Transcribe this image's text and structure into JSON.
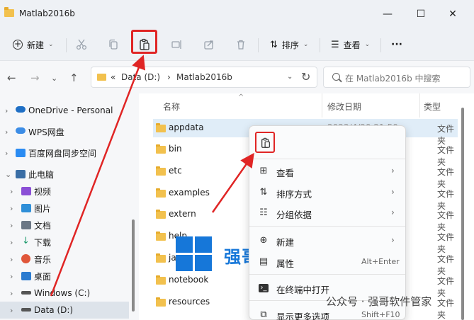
{
  "window": {
    "title": "Matlab2016b"
  },
  "window_controls": {
    "minimize": "—",
    "maximize": "☐",
    "close": "✕"
  },
  "toolbar": {
    "new_label": "新建",
    "sort_label": "排序",
    "view_label": "查看",
    "more_label": "···",
    "icons": [
      "cut-icon",
      "copy-icon",
      "paste-icon",
      "rename-icon",
      "share-icon",
      "delete-icon"
    ]
  },
  "address": {
    "overflow": "«",
    "drive": "Data (D:)",
    "separator": "›",
    "folder": "Matlab2016b"
  },
  "search": {
    "placeholder": "在 Matlab2016b 中搜索"
  },
  "sidebar": {
    "items": [
      {
        "label": "OneDrive - Personal",
        "icon": "onedrive-icon",
        "color": "#1f6fc5"
      },
      {
        "label": "WPS网盘",
        "icon": "wps-cloud-icon",
        "color": "#3c8de6"
      },
      {
        "label": "百度网盘同步空间",
        "icon": "baidu-netdisk-icon",
        "color": "#2a8bf2"
      },
      {
        "label": "此电脑",
        "icon": "this-pc-icon",
        "color": "#3a6ea5"
      },
      {
        "label": "视频",
        "icon": "videos-icon",
        "color": "#8b4fd6"
      },
      {
        "label": "图片",
        "icon": "pictures-icon",
        "color": "#2f8fd8"
      },
      {
        "label": "文档",
        "icon": "documents-icon",
        "color": "#6b7785"
      },
      {
        "label": "下载",
        "icon": "downloads-icon",
        "color": "#1d9a6c"
      },
      {
        "label": "音乐",
        "icon": "music-icon",
        "color": "#e0573a"
      },
      {
        "label": "桌面",
        "icon": "desktop-icon",
        "color": "#2b7bd0"
      },
      {
        "label": "Windows (C:)",
        "icon": "drive-c-icon",
        "color": "#555555"
      },
      {
        "label": "Data (D:)",
        "icon": "drive-d-icon",
        "color": "#555555"
      }
    ]
  },
  "columns": {
    "name": "名称",
    "modified": "修改日期",
    "type": "类型"
  },
  "files": [
    {
      "name": "appdata",
      "date": "2023/4/20 21:50",
      "type": "文件夹"
    },
    {
      "name": "bin",
      "date": "",
      "type": "文件夹"
    },
    {
      "name": "etc",
      "date": "",
      "type": "文件夹"
    },
    {
      "name": "examples",
      "date": "",
      "type": "文件夹"
    },
    {
      "name": "extern",
      "date": "",
      "type": "文件夹"
    },
    {
      "name": "help",
      "date": "",
      "type": "文件夹"
    },
    {
      "name": "java",
      "date": "",
      "type": "文件夹"
    },
    {
      "name": "notebook",
      "date": "",
      "type": "文件夹"
    },
    {
      "name": "resources",
      "date": "",
      "type": "文件夹"
    }
  ],
  "context_menu": {
    "items": [
      {
        "label": "查看",
        "icon": "grid-view-icon",
        "chevron": "›"
      },
      {
        "label": "排序方式",
        "icon": "sort-icon",
        "chevron": "›"
      },
      {
        "label": "分组依据",
        "icon": "group-by-icon",
        "chevron": "›"
      },
      {
        "label": "新建",
        "icon": "new-plus-icon",
        "chevron": "›"
      },
      {
        "label": "属性",
        "icon": "properties-icon",
        "shortcut": "Alt+Enter"
      },
      {
        "label": "在终端中打开",
        "icon": "terminal-icon"
      },
      {
        "label": "显示更多选项",
        "icon": "more-options-icon",
        "shortcut": "Shift+F10"
      }
    ]
  },
  "watermark": {
    "brand": "强哥软件管家",
    "account": "公众号 · 强哥软件管家"
  },
  "colors": {
    "highlight": "#e02525",
    "accent": "#1677d9",
    "folder": "#f2c14e"
  }
}
